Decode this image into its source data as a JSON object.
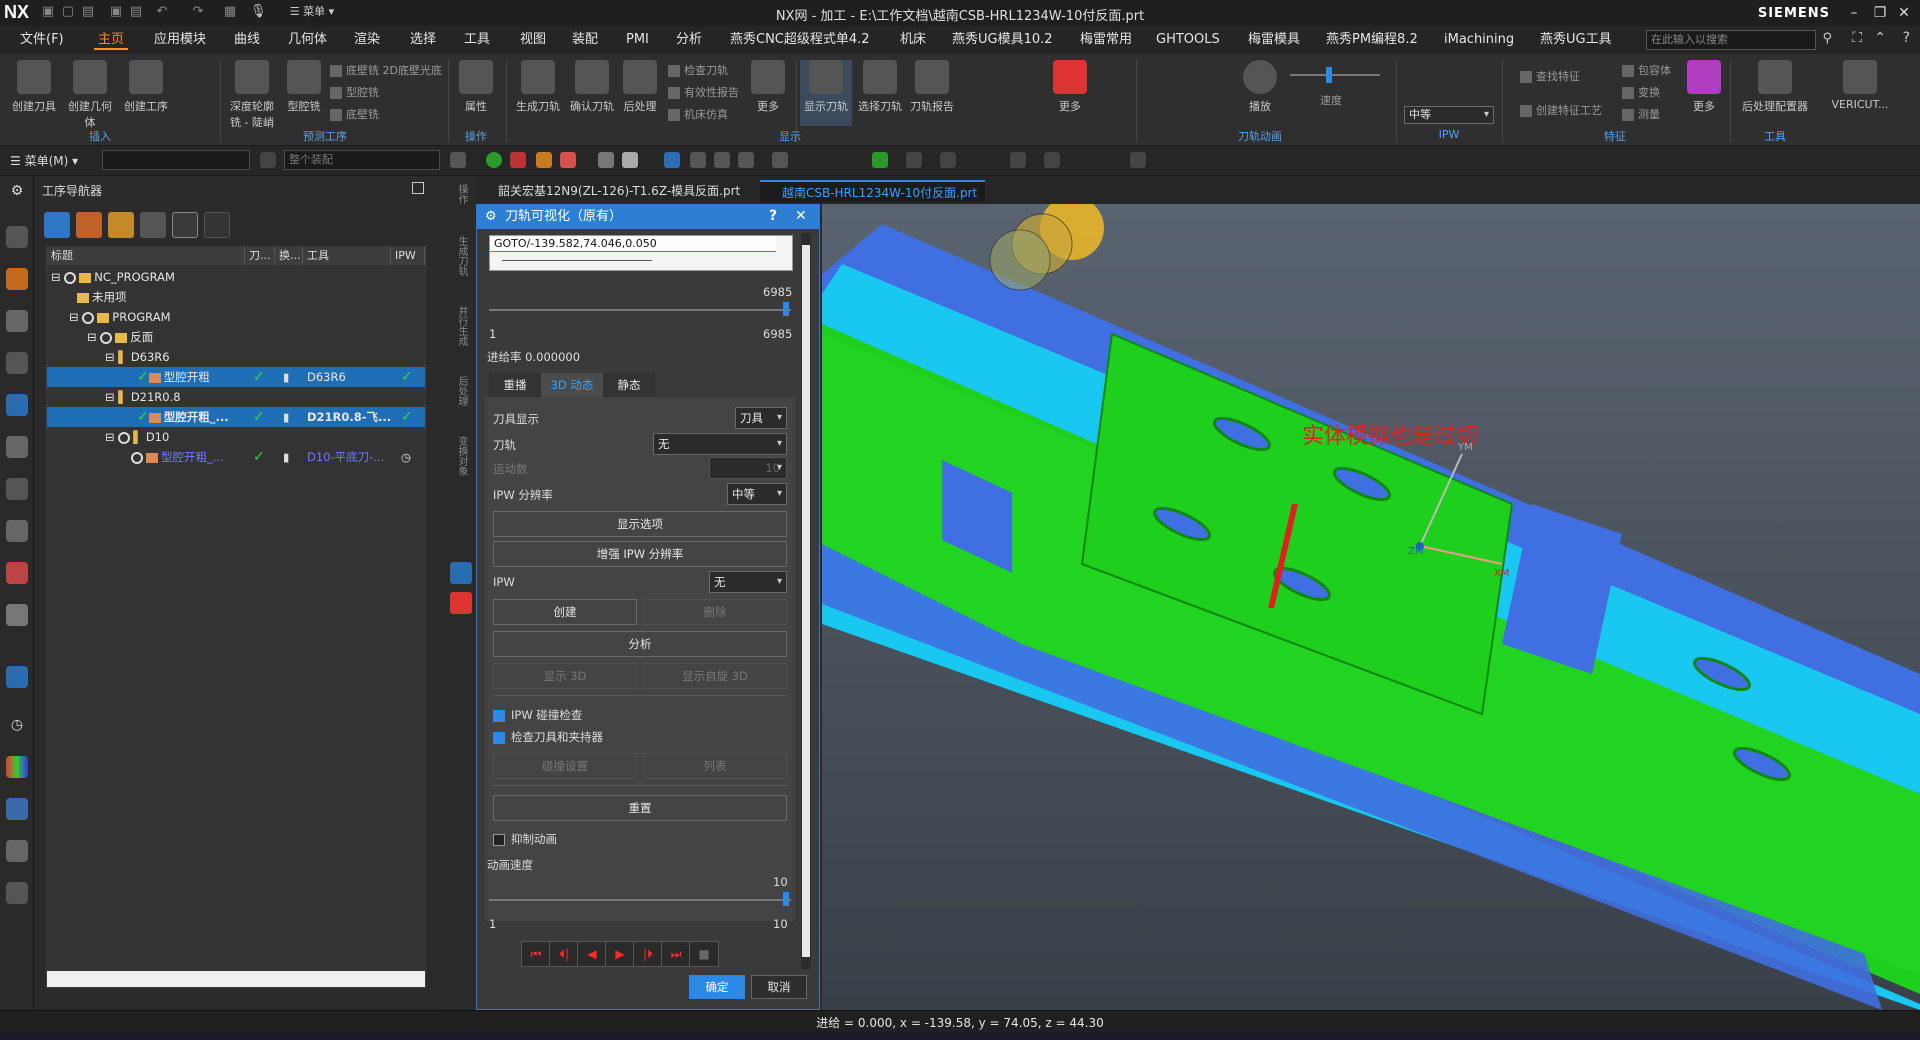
{
  "app": {
    "logo": "NX",
    "window_title": "NX网 - 加工 - E:\\工作文档\\越南CSB-HRL1234W-10付反面.prt",
    "brand": "SIEMENS"
  },
  "menubar": {
    "file": "文件(F)",
    "items": [
      "主页",
      "应用模块",
      "曲线",
      "几何体",
      "渲染",
      "选择",
      "工具",
      "视图",
      "装配",
      "PMI",
      "分析",
      "燕秀CNC超级程式单4.2",
      "机床",
      "燕秀UG模具10.2",
      "梅雷常用",
      "GHTOOLS",
      "梅雷模具",
      "燕秀PM编程8.2",
      "iMachining",
      "燕秀UG工具"
    ],
    "search_placeholder": "在此输入以搜索"
  },
  "ribbon": {
    "buttons": [
      "创建刀具",
      "创建几何体",
      "创建工序",
      "深度轮廓铣 - 陡峭",
      "型腔铣",
      "属性",
      "生成刀轨",
      "确认刀轨",
      "后处理",
      "更多",
      "显示刀轨",
      "选择刀轨",
      "刀轨报告",
      "更多",
      "播放",
      "更多",
      "后处理配置器",
      "VERICUT..."
    ],
    "small_items": [
      "底壁铣 2D底壁光底",
      "型腔铣",
      "底壁铣",
      "检查刀轨",
      "有效性报告",
      "机床仿真",
      "查找特征",
      "创建特征工艺",
      "包容体",
      "变换",
      "测量"
    ],
    "groups": [
      "插入",
      "预测工序",
      "操作",
      "显示",
      "刀轨动画",
      "IPW",
      "特征",
      "工具"
    ],
    "speed_label": "速度",
    "ipw_value": "中等"
  },
  "toolbar2": {
    "menu_label": "菜单(M)",
    "assembly_combo": "整个装配"
  },
  "navigator": {
    "title": "工序导航器",
    "columns": [
      "标题",
      "刀...",
      "换...",
      "工具",
      "IPW"
    ],
    "rows": [
      {
        "name": "NC_PROGRAM",
        "tool": "",
        "check": "",
        "ipw": ""
      },
      {
        "name": "未用项",
        "tool": "",
        "check": "",
        "ipw": ""
      },
      {
        "name": "PROGRAM",
        "tool": "",
        "check": "",
        "ipw": ""
      },
      {
        "name": "反面",
        "tool": "",
        "check": "",
        "ipw": ""
      },
      {
        "name": "D63R6",
        "tool": "",
        "check": "",
        "ipw": ""
      },
      {
        "name": "型腔开粗",
        "tool": "D63R6",
        "check": "✓",
        "ipw": "✓"
      },
      {
        "name": "D21R0.8",
        "tool": "",
        "check": "",
        "ipw": ""
      },
      {
        "name": "型腔开粗_...",
        "tool": "D21R0.8-飞...",
        "check": "✓",
        "ipw": "✓"
      },
      {
        "name": "D10",
        "tool": "",
        "check": "",
        "ipw": ""
      },
      {
        "name": "型腔开粗_...",
        "tool": "D10-平底刀-...",
        "check": "✓",
        "ipw": "◷"
      }
    ]
  },
  "side_strip": [
    "操作",
    "生成刀轨",
    "并行生成",
    "后处理",
    "变换对象"
  ],
  "tabs": [
    {
      "label": "韶关宏基12N9(ZL-126)-T1.6Z-模具反面.prt",
      "active": false
    },
    {
      "label": "越南CSB-HRL1234W-10付反面.prt",
      "active": true
    }
  ],
  "dialog": {
    "title": "刀轨可视化（原有）",
    "help": "?",
    "close": "✕",
    "goto_text": "GOTO/-139.582,74.046,0.050",
    "slider_max_top": "6985",
    "slider_min": "1",
    "slider_max": "6985",
    "feed_rate": "进给率 0.000000",
    "subtabs": [
      "重播",
      "3D 动态",
      "静态"
    ],
    "tool_display_label": "刀具显示",
    "tool_display_value": "刀具",
    "toolpath_label": "刀轨",
    "toolpath_value": "无",
    "motion_label": "运动数",
    "motion_value": "10",
    "ipw_res_label": "IPW 分辨率",
    "ipw_res_value": "中等",
    "display_options": "显示选项",
    "enhance_ipw": "增强 IPW 分辨率",
    "ipw_label": "IPW",
    "ipw_value": "无",
    "create": "创建",
    "delete": "删除",
    "analyze": "分析",
    "show_3d": "显示 3D",
    "show_rot_3d": "显示自旋 3D",
    "ipw_collision": "IPW 碰撞检查",
    "check_holder": "检查刀具和夹持器",
    "collision_settings": "碰撞设置",
    "list": "列表",
    "reset": "重置",
    "suppress_anim": "抑制动画",
    "anim_speed": "动画速度",
    "speed_max_top": "10",
    "speed_min": "1",
    "speed_max": "10",
    "ok": "确定",
    "cancel": "取消"
  },
  "viewport": {
    "annotation": "实体模拟也是过切",
    "axis_labels": [
      "YM",
      "ZM",
      "XM"
    ]
  },
  "status": "进给 = 0.000, x = -139.58, y = 74.05, z = 44.30",
  "colors": {
    "accent": "#ff8a1e",
    "selection": "#1f6fb6",
    "model_green": "#1ecf1e",
    "model_cyan": "#18c8f0",
    "model_blue": "#3f6fe0",
    "annotation": "#e02020"
  }
}
